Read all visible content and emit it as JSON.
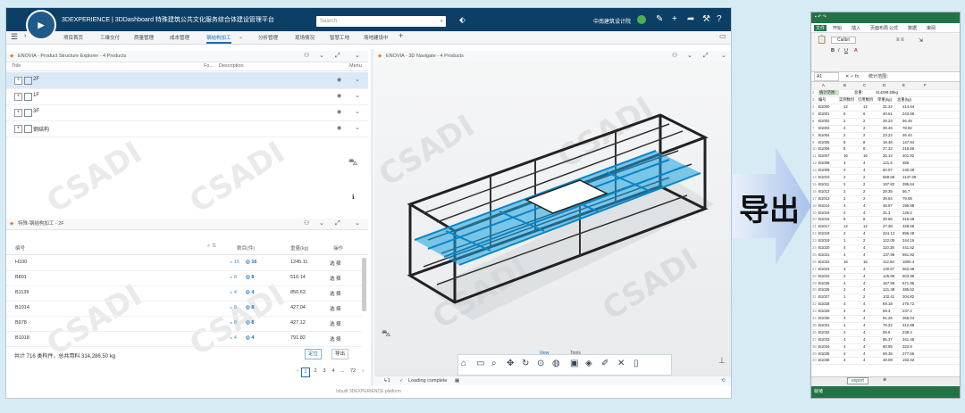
{
  "app": {
    "brand": "3DEXPERIENCE | 3DDashboard 特殊建筑公共文化服务综合体建设管理平台",
    "search_placeholder": "Search",
    "org": "中南建筑设计院",
    "tabs": [
      "项目首页",
      "三维交付",
      "质量管理",
      "成本管理",
      "钢结构加工",
      "分析管理",
      "现场情况",
      "智慧工地",
      "场地建设中"
    ],
    "active_tab": 4,
    "footer": "Inbuilt 3DEXPERIENCE platform"
  },
  "explorer": {
    "title": "ENOVIA - Product Structure Explorer - 4 Products",
    "columns": [
      "Title",
      "Fo...",
      "Description",
      "Menu"
    ],
    "rows": [
      {
        "label": "2F",
        "selected": true
      },
      {
        "label": "1F",
        "selected": false
      },
      {
        "label": "3F",
        "selected": false
      },
      {
        "label": "钢结构",
        "selected": false
      }
    ]
  },
  "table": {
    "title": "特殊-钢结构加工 - 2F",
    "columns": [
      "编号",
      "数目(件)",
      "重量(kg)",
      "操作"
    ],
    "rows": [
      {
        "id": "H100",
        "count_a": "15",
        "count_b": "16",
        "weight": "1245.11",
        "op": "选 择"
      },
      {
        "id": "B801",
        "count_a": "8",
        "count_b": "8",
        "weight": "516.14",
        "op": "选 择"
      },
      {
        "id": "B1139",
        "count_a": "4",
        "count_b": "4",
        "weight": "850.63",
        "op": "选 择"
      },
      {
        "id": "B1014",
        "count_a": "8",
        "count_b": "8",
        "weight": "427.04",
        "op": "选 择"
      },
      {
        "id": "B978",
        "count_a": "8",
        "count_b": "8",
        "weight": "427.12",
        "op": "选 择"
      },
      {
        "id": "B1018",
        "count_a": "4",
        "count_b": "4",
        "weight": "791.82",
        "op": "选 择"
      }
    ],
    "summary": "共计 716 类构件，总共用料 314,286.50 kg",
    "locate_label": "定位",
    "export_label": "导出",
    "pages": [
      "1",
      "2",
      "3",
      "4",
      "...",
      "72"
    ]
  },
  "viewer": {
    "title": "ENOVIA - 3D Navigate - 4 Products",
    "status": "Loading complete",
    "tabs": [
      "View",
      "Tools"
    ]
  },
  "arrow_label": "导出",
  "excel": {
    "menu": [
      "文件",
      "开始",
      "插入",
      "页面布局",
      "公式",
      "数据",
      "审阅"
    ],
    "font": "Calibri",
    "cellref": "A1",
    "formula": "统计范围：",
    "header_row": [
      "统计范围：",
      "总重：",
      "314298.50kg"
    ],
    "col_headers": [
      "编号",
      "实例数目",
      "引用数目",
      "单重(kg)",
      "总重(kg)"
    ],
    "rows": [
      [
        "B1000",
        "12",
        "12",
        "31.22",
        "414.64"
      ],
      [
        "B1001",
        "6",
        "6",
        "40.61",
        "243.66"
      ],
      [
        "B1002",
        "2",
        "2",
        "28.23",
        "56.46"
      ],
      [
        "B1003",
        "2",
        "2",
        "39.46",
        "78.92"
      ],
      [
        "B1004",
        "2",
        "2",
        "23.22",
        "46.44"
      ],
      [
        "B1005",
        "8",
        "8",
        "18.48",
        "147.84"
      ],
      [
        "B1006",
        "8",
        "8",
        "27.32",
        "218.56"
      ],
      [
        "B1007",
        "16",
        "16",
        "25.12",
        "401.92"
      ],
      [
        "B1008",
        "4",
        "4",
        "121.5",
        "486"
      ],
      [
        "B1009",
        "4",
        "4",
        "60.07",
        "240.28"
      ],
      [
        "B1010",
        "2",
        "2",
        "568.68",
        "1137.36"
      ],
      [
        "B1011",
        "2",
        "2",
        "197.82",
        "395.64"
      ],
      [
        "B1012",
        "2",
        "2",
        "28.35",
        "56.7"
      ],
      [
        "B1013",
        "2",
        "2",
        "39.54",
        "79.08"
      ],
      [
        "B1014",
        "4",
        "4",
        "48.97",
        "195.88"
      ],
      [
        "B1015",
        "4",
        "4",
        "31.3",
        "125.2"
      ],
      [
        "B1016",
        "8",
        "8",
        "39.56",
        "316.48"
      ],
      [
        "B1017",
        "12",
        "12",
        "27.38",
        "328.56"
      ],
      [
        "B1018",
        "2",
        "4",
        "224.12",
        "896.48"
      ],
      [
        "B1019",
        "1",
        "2",
        "122.08",
        "244.16"
      ],
      [
        "B1020",
        "4",
        "4",
        "110.38",
        "441.52"
      ],
      [
        "B1021",
        "4",
        "4",
        "137.98",
        "551.92"
      ],
      [
        "B1022",
        "16",
        "16",
        "112.53",
        "1800.4"
      ],
      [
        "B1023",
        "4",
        "4",
        "140.67",
        "562.68"
      ],
      [
        "B1024",
        "4",
        "4",
        "125.99",
        "503.96"
      ],
      [
        "B1025",
        "4",
        "4",
        "167.99",
        "671.96"
      ],
      [
        "B1026",
        "2",
        "4",
        "121.38",
        "485.52"
      ],
      [
        "B1027",
        "1",
        "2",
        "102.41",
        "204.82"
      ],
      [
        "B1028",
        "4",
        "4",
        "69.18",
        "276.72"
      ],
      [
        "B1029",
        "4",
        "4",
        "59.3",
        "237.2"
      ],
      [
        "B1030",
        "4",
        "4",
        "91.26",
        "365.04"
      ],
      [
        "B1031",
        "4",
        "4",
        "78.22",
        "312.88"
      ],
      [
        "B1032",
        "4",
        "4",
        "59.6",
        "238.4"
      ],
      [
        "B1033",
        "4",
        "4",
        "85.37",
        "341.48"
      ],
      [
        "B1034",
        "4",
        "4",
        "80.95",
        "323.8"
      ],
      [
        "B1035",
        "4",
        "4",
        "69.39",
        "277.56"
      ],
      [
        "B1036",
        "4",
        "4",
        "48.08",
        "192.32"
      ]
    ],
    "sheet": "export",
    "status": "就绪"
  }
}
